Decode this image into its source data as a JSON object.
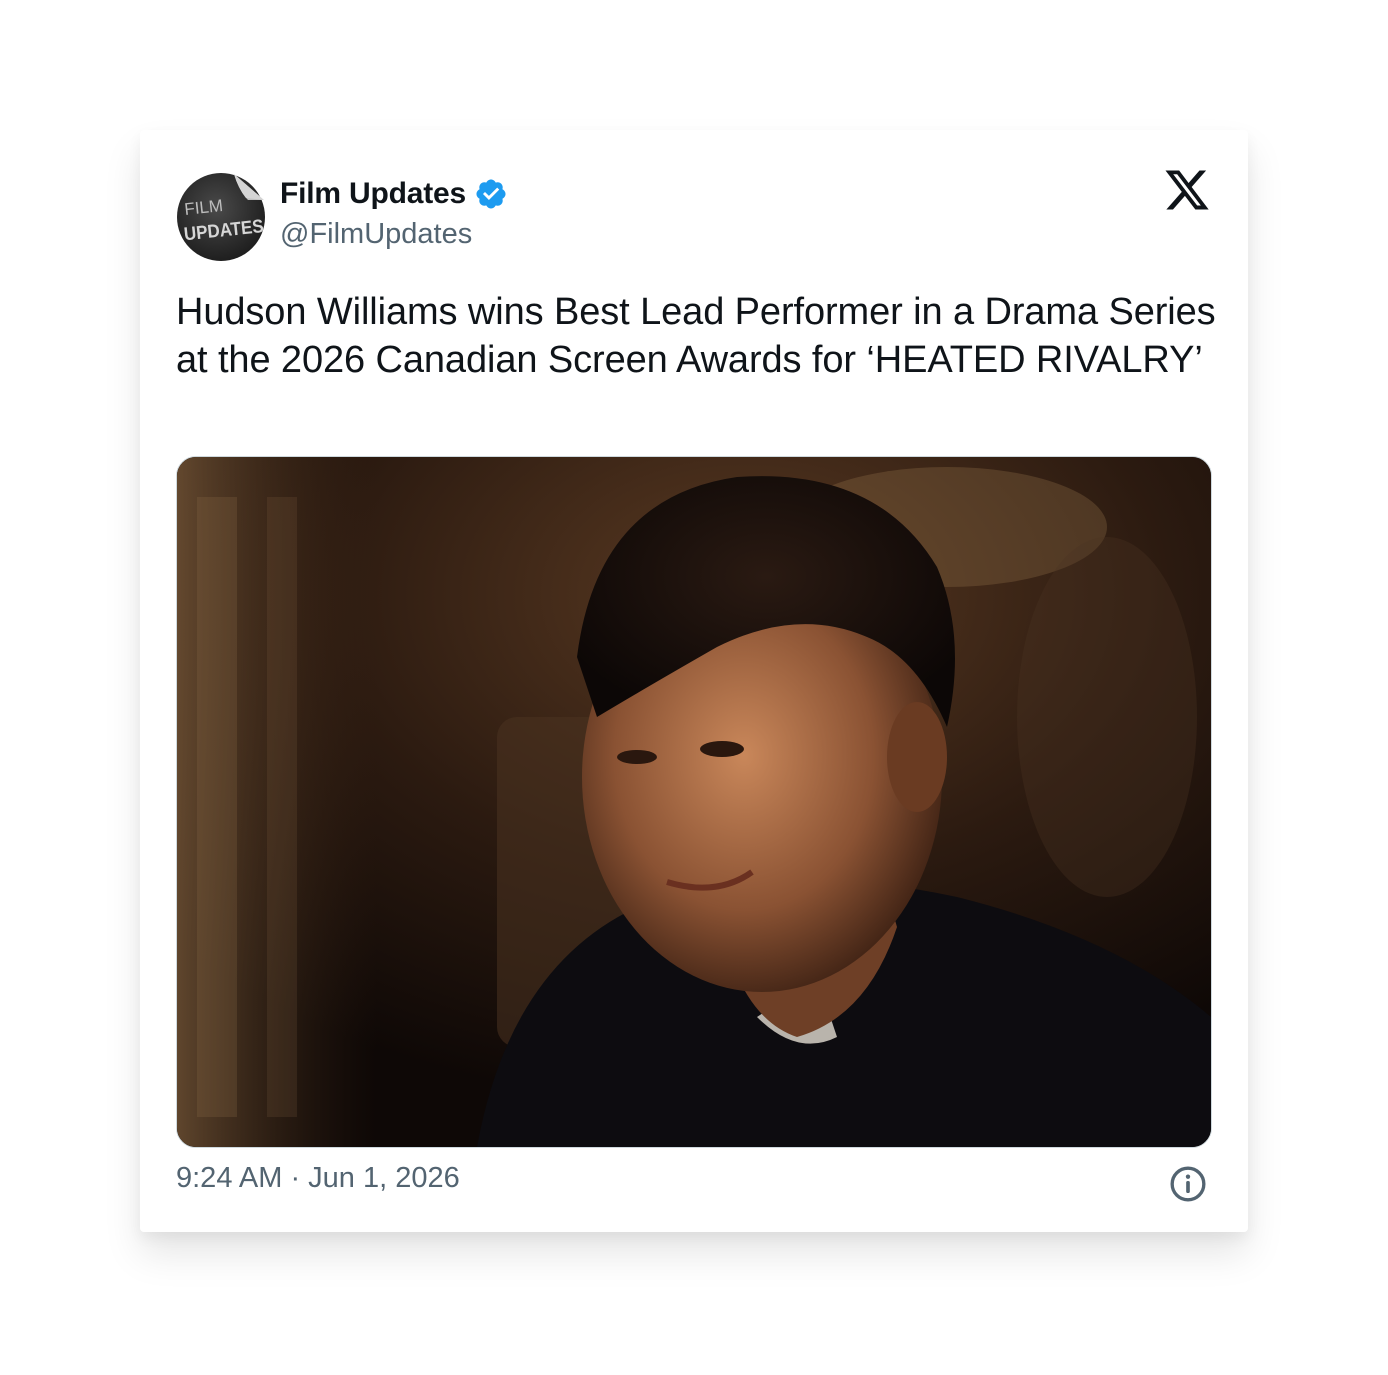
{
  "post": {
    "author": {
      "display_name": "Film Updates",
      "handle": "@FilmUpdates",
      "avatar_text_line1": "FILM",
      "avatar_text_line2": "UPDATES",
      "verified": true
    },
    "text": "Hudson Williams wins Best Lead Performer in a Drama Series at the 2026 Canadian Screen Awards for ‘HEATED RIVALRY’",
    "timestamp": "9:24 AM · Jun 1, 2026"
  },
  "icons": {
    "platform_logo": "x-logo-icon",
    "verified_badge": "verified-badge-icon",
    "info": "info-icon"
  },
  "colors": {
    "verified_blue": "#1d9bf0",
    "text_primary": "#0f1419",
    "text_secondary": "#536471"
  }
}
